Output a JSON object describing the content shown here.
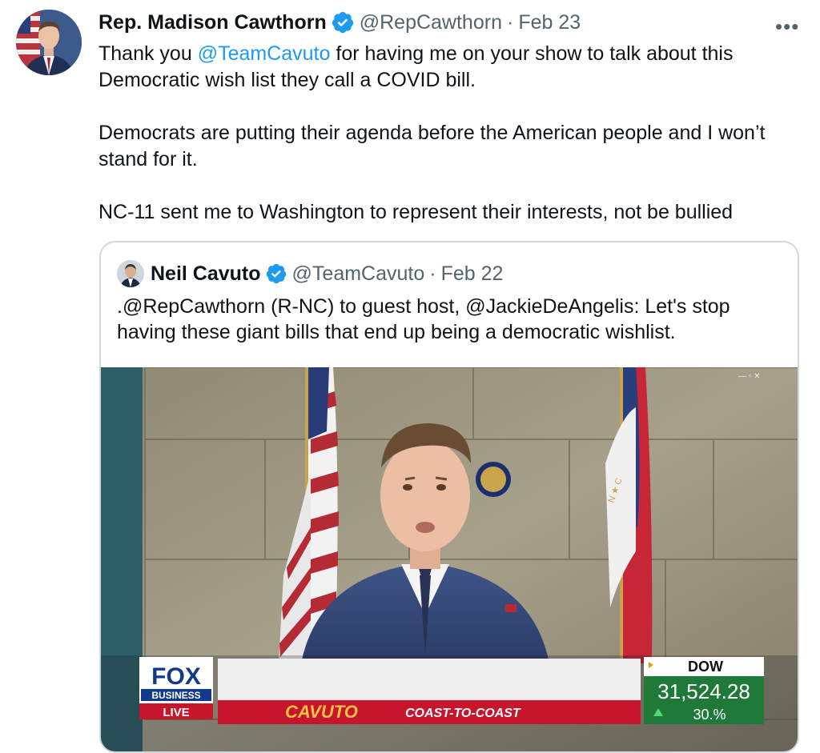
{
  "tweet": {
    "display_name": "Rep. Madison Cawthorn",
    "handle": "@RepCawthorn",
    "separator": "·",
    "date": "Feb 23",
    "more_icon": "more-horizontal-icon",
    "body": {
      "line1_prefix": "Thank you ",
      "mention": "@TeamCavuto",
      "line1_suffix": " for having me on your show to talk about this Democratic wish list they call a COVID bill.",
      "para2": "Democrats are putting their agenda before the American people and I won’t stand for it.",
      "para3": "NC-11 sent me to Washington to represent their interests, not be bullied"
    }
  },
  "quoted": {
    "display_name": "Neil Cavuto",
    "handle": "@TeamCavuto",
    "separator": "·",
    "date": "Feb 22",
    "body_prefix": ".@RepCawthorn  (R-NC) to guest host, ",
    "mention": "@JackieDeAngelis",
    "body_suffix": ": Let's stop having these giant bills that end up being a democratic wishlist.",
    "video": {
      "network_logo_top": "FOX",
      "network_logo_bottom": "BUSINESS",
      "live_label": "LIVE",
      "show_name": "CAVUTO",
      "show_suffix": "COAST-TO-COAST",
      "ticker_label": "DOW",
      "ticker_value": "31,524.28",
      "ticker_change": "30.%",
      "colors": {
        "ticker_green": "#1f7a3a",
        "fox_blue": "#123a8c",
        "banner_red": "#c7162b"
      }
    }
  },
  "colors": {
    "accent": "#1d9bf0",
    "verified": "#1d9bf0",
    "muted": "#536471",
    "border": "#cfd9de"
  }
}
